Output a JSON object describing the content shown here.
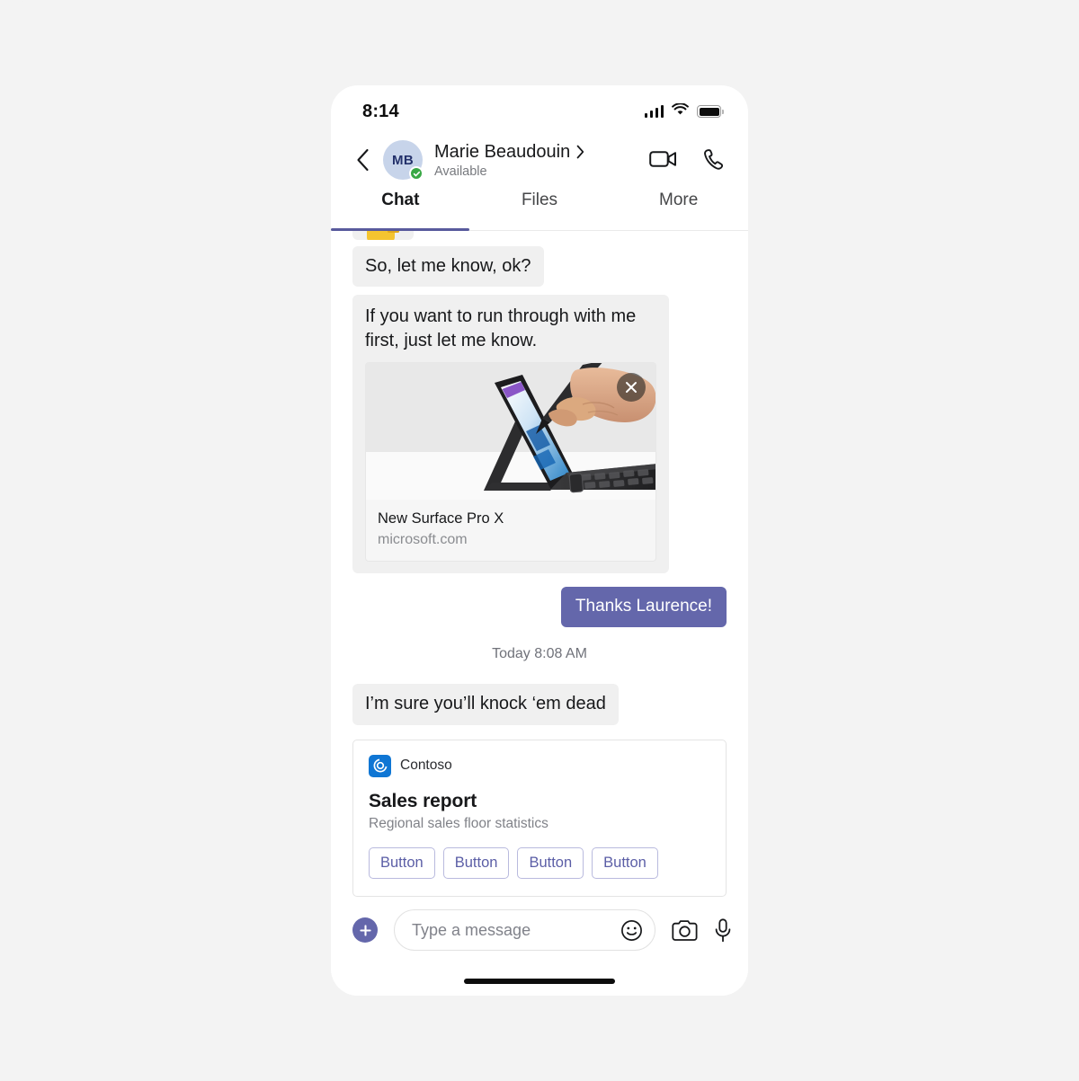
{
  "status_bar": {
    "time": "8:14",
    "signal_icon": "signal-bars-icon",
    "wifi_icon": "wifi-icon",
    "battery_icon": "battery-full-icon"
  },
  "header": {
    "back_icon": "chevron-left-icon",
    "avatar_initials": "MB",
    "avatar_bg": "#c7d4ea",
    "presence": "available",
    "presence_color": "#39a845",
    "contact_name": "Marie Beaudouin",
    "name_chevron": "›",
    "status_text": "Available",
    "video_call_icon": "video-camera-icon",
    "audio_call_icon": "phone-icon"
  },
  "tabs": {
    "items": [
      {
        "label": "Chat",
        "active": true
      },
      {
        "label": "Files",
        "active": false
      },
      {
        "label": "More",
        "active": false
      }
    ],
    "indicator_color": "#585a9c"
  },
  "conversation": {
    "sticker_message": {
      "type": "sticker",
      "icon": "hand-emoji",
      "clipped": true
    },
    "messages": [
      {
        "id": "m1",
        "direction": "incoming",
        "text": "So, let me know, ok?"
      },
      {
        "id": "m2",
        "direction": "incoming",
        "text": "If you want to run through with me first, just let me know.",
        "link_card": {
          "title": "New Surface Pro X",
          "domain": "microsoft.com",
          "image_alt": "surface-pro-x-with-stylus",
          "close_icon": "close-icon"
        }
      },
      {
        "id": "m3",
        "direction": "outgoing",
        "text": "Thanks Laurence!",
        "bubble_color": "#6467ab"
      }
    ],
    "timestamp": "Today 8:08 AM",
    "messages_after": [
      {
        "id": "m4",
        "direction": "incoming",
        "text": "I’m sure you’ll knock ‘em dead"
      }
    ],
    "adaptive_card": {
      "app_name": "Contoso",
      "app_icon": "contoso-logo-icon",
      "app_icon_color": "#0f76d4",
      "title": "Sales report",
      "subtitle": "Regional sales floor statistics",
      "buttons": [
        {
          "label": "Button"
        },
        {
          "label": "Button"
        },
        {
          "label": "Button"
        },
        {
          "label": "Button"
        }
      ],
      "button_color": "#5b5ea6"
    }
  },
  "composer": {
    "add_icon": "plus-icon",
    "add_color": "#6467ab",
    "input_value": "",
    "placeholder": "Type a message",
    "emoji_icon": "smiley-icon",
    "camera_icon": "camera-icon",
    "mic_icon": "microphone-icon"
  },
  "home_indicator": {
    "visible": true
  }
}
